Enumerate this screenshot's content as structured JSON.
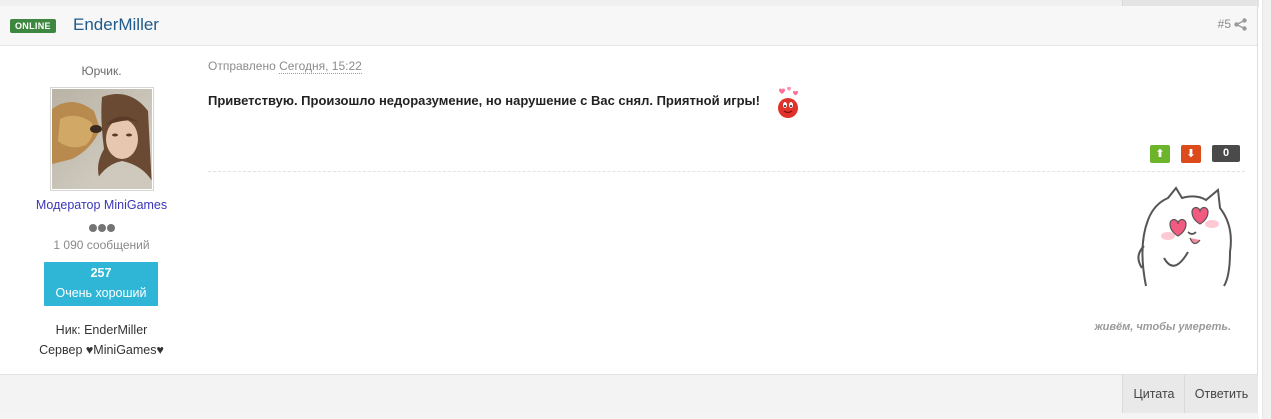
{
  "post": {
    "online_badge": "ONLINE",
    "username": "EnderMiller",
    "post_number": "#5",
    "share_icon": "share-icon",
    "author": {
      "title": "Юрчик.",
      "role": "Модератор MiniGames",
      "post_count": "1 090 сообщений",
      "reputation_value": "257",
      "reputation_label": "Очень хороший",
      "nick_line": "Ник: EnderMiller",
      "server_line": "Сервер ♥MiniGames♥"
    },
    "sent_prefix": "Отправлено",
    "sent_date": "Сегодня, 15:22",
    "message": "Приветствую. Произошло недоразумение, но нарушение с Вас снял. Приятной игры!",
    "votes": {
      "up_icon": "arrow-up-icon",
      "down_icon": "arrow-down-icon",
      "up_glyph": "⬆",
      "down_glyph": "⬇",
      "count": "0"
    },
    "signature_text": "живём, чтобы умереть.",
    "buttons": {
      "quote": "Цитата",
      "reply": "Ответить"
    }
  },
  "colors": {
    "online_badge": "#3e8740",
    "username": "#1f5a8a",
    "role": "#3a36b8",
    "reputation_box": "#2fb6d6",
    "vote_up": "#6cb42a",
    "vote_down": "#dd4b1c",
    "vote_count": "#4a4a4a"
  }
}
